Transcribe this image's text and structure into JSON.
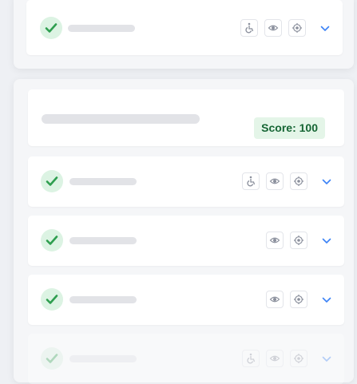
{
  "summary": {
    "score_text": "Score: 100"
  },
  "icons": {
    "status": "check-icon",
    "accessibility": "wheelchair-icon",
    "visibility": "eye-icon",
    "target": "crosshair-icon",
    "expand": "chevron-down-icon"
  },
  "colors": {
    "success": "#2e9e4f",
    "success_bg": "#dcf3e3",
    "accent": "#3b82f6",
    "score_text": "#166534",
    "score_bg": "#e4f5e8",
    "icon_muted": "#8a8f9c"
  }
}
